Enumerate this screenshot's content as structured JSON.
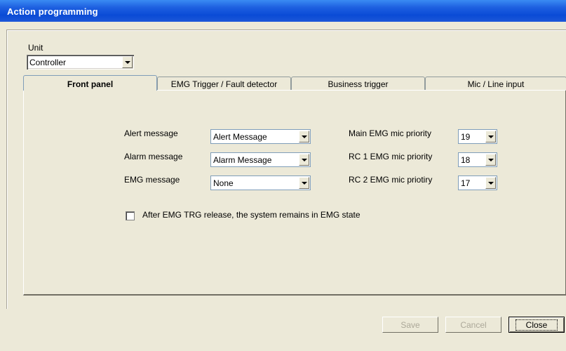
{
  "window": {
    "title": "Action programming"
  },
  "unit": {
    "label": "Unit",
    "value": "Controller"
  },
  "tabs": [
    {
      "label": "Front panel",
      "active": true
    },
    {
      "label": "EMG Trigger / Fault detector",
      "active": false
    },
    {
      "label": "Business trigger",
      "active": false
    },
    {
      "label": "Mic / Line input",
      "active": false
    }
  ],
  "front_panel": {
    "alert": {
      "label": "Alert message",
      "value": "Alert Message"
    },
    "alarm": {
      "label": "Alarm message",
      "value": "Alarm Message"
    },
    "emg": {
      "label": "EMG message",
      "value": "None"
    },
    "main_priority": {
      "label": "Main EMG mic priority",
      "value": "19"
    },
    "rc1_priority": {
      "label": "RC 1 EMG mic priority",
      "value": "18"
    },
    "rc2_priority": {
      "label": "RC 2 EMG mic priotiry",
      "value": "17"
    },
    "remain_emg": {
      "label": "After EMG TRG release, the system remains in EMG state",
      "checked": false
    }
  },
  "buttons": {
    "save": "Save",
    "cancel": "Cancel",
    "close": "Close"
  }
}
